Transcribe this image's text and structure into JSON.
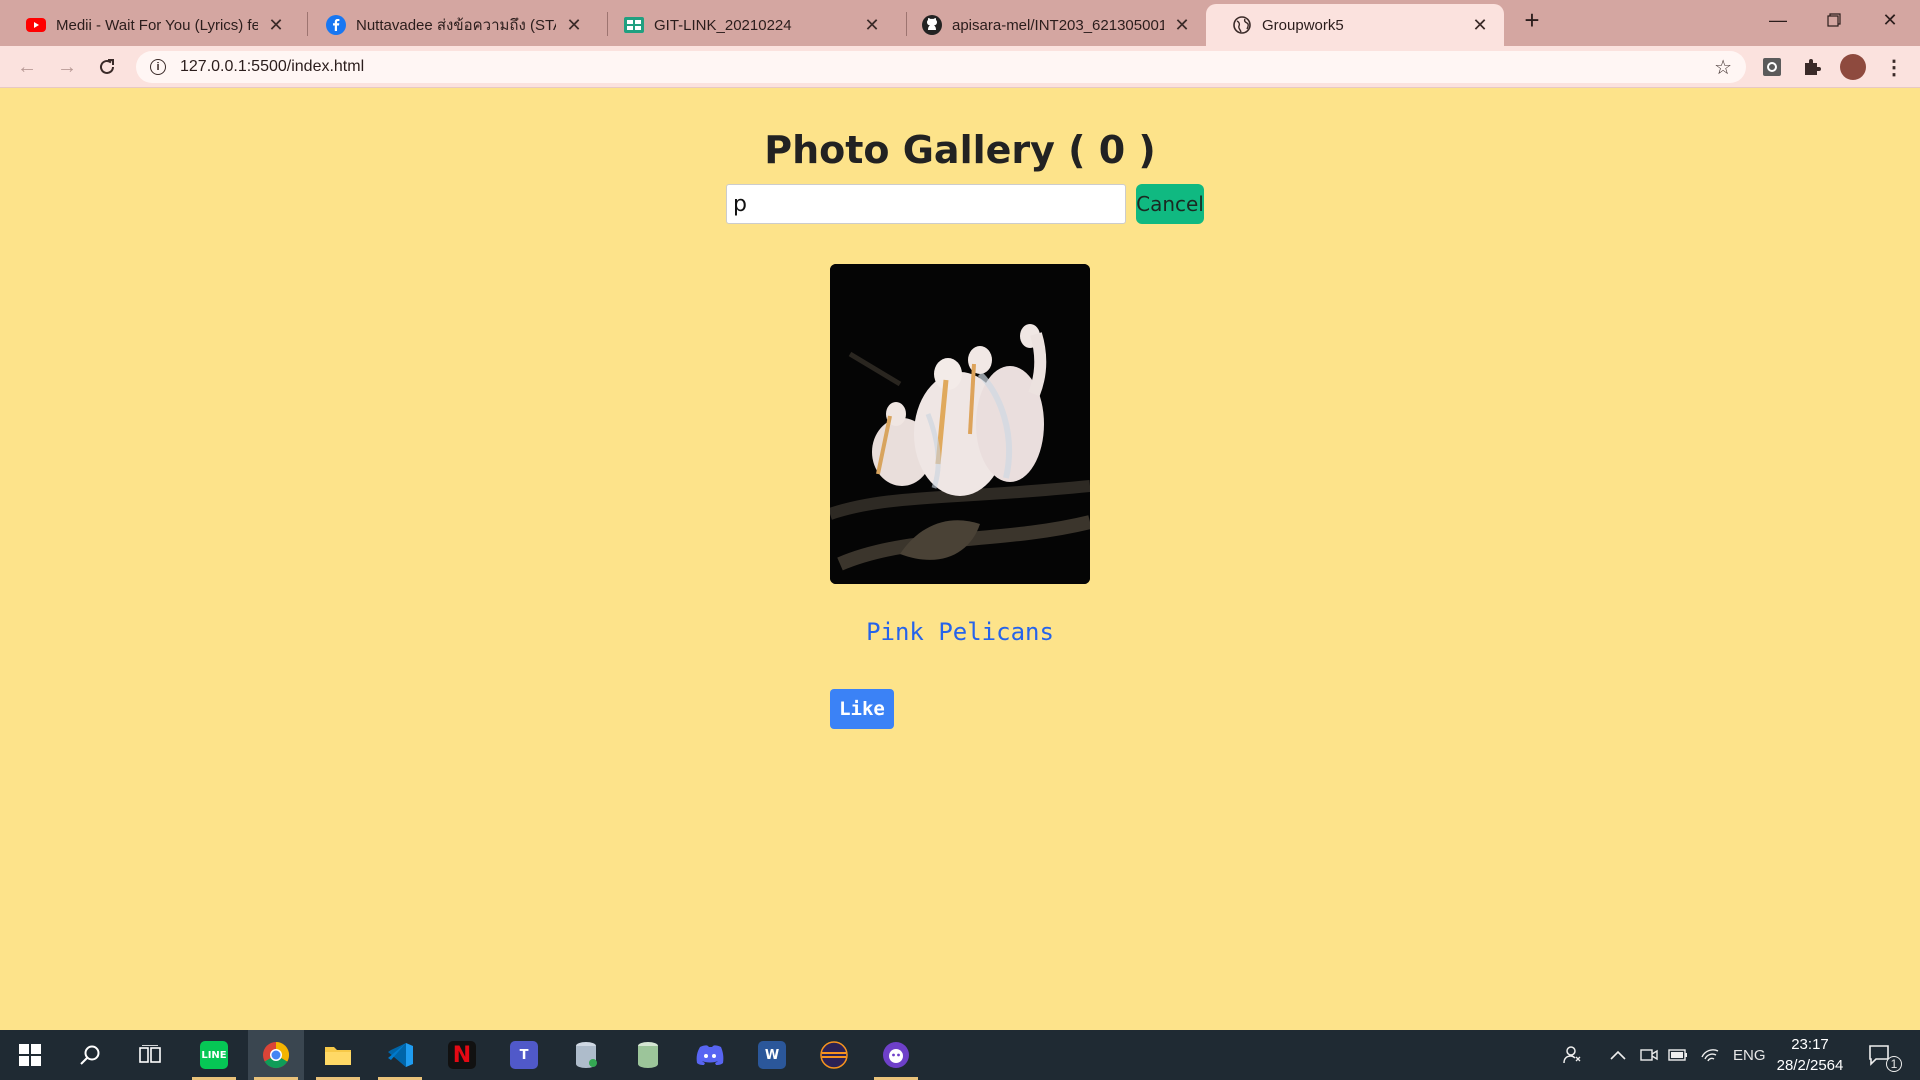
{
  "browser": {
    "tabs": [
      {
        "title": "Medii - Wait For You (Lyrics) feat.",
        "icon": "youtube-icon"
      },
      {
        "title": "Nuttavadee ส่งข้อความถึง (STAFF) S",
        "icon": "facebook-icon"
      },
      {
        "title": "GIT-LINK_20210224",
        "icon": "sheets-icon"
      },
      {
        "title": "apisara-mel/INT203_62130500107",
        "icon": "github-icon"
      },
      {
        "title": "Groupwork5",
        "icon": "globe-icon"
      }
    ],
    "active_tab": 4,
    "url": "127.0.0.1:5500/index.html"
  },
  "page": {
    "title": "Photo Gallery ( 0 )",
    "search_value": "p",
    "cancel_label": "Cancel",
    "photo_alt": "Pink Pelicans",
    "caption": "Pink Pelicans",
    "like_label": "Like"
  },
  "taskbar": {
    "apps": [
      "line",
      "chrome",
      "file-explorer",
      "vscode",
      "netflix",
      "teams",
      "database",
      "database-2",
      "discord",
      "word",
      "eclipse",
      "github-desktop"
    ],
    "language": "ENG",
    "time": "23:17",
    "date": "28/2/2564",
    "notification_count": "1"
  },
  "colors": {
    "page_bg": "#fde38a",
    "tab_strip": "#d4a6a1",
    "cancel_button": "#10b981",
    "like_button": "#3b82f6",
    "caption_text": "#2563eb"
  }
}
